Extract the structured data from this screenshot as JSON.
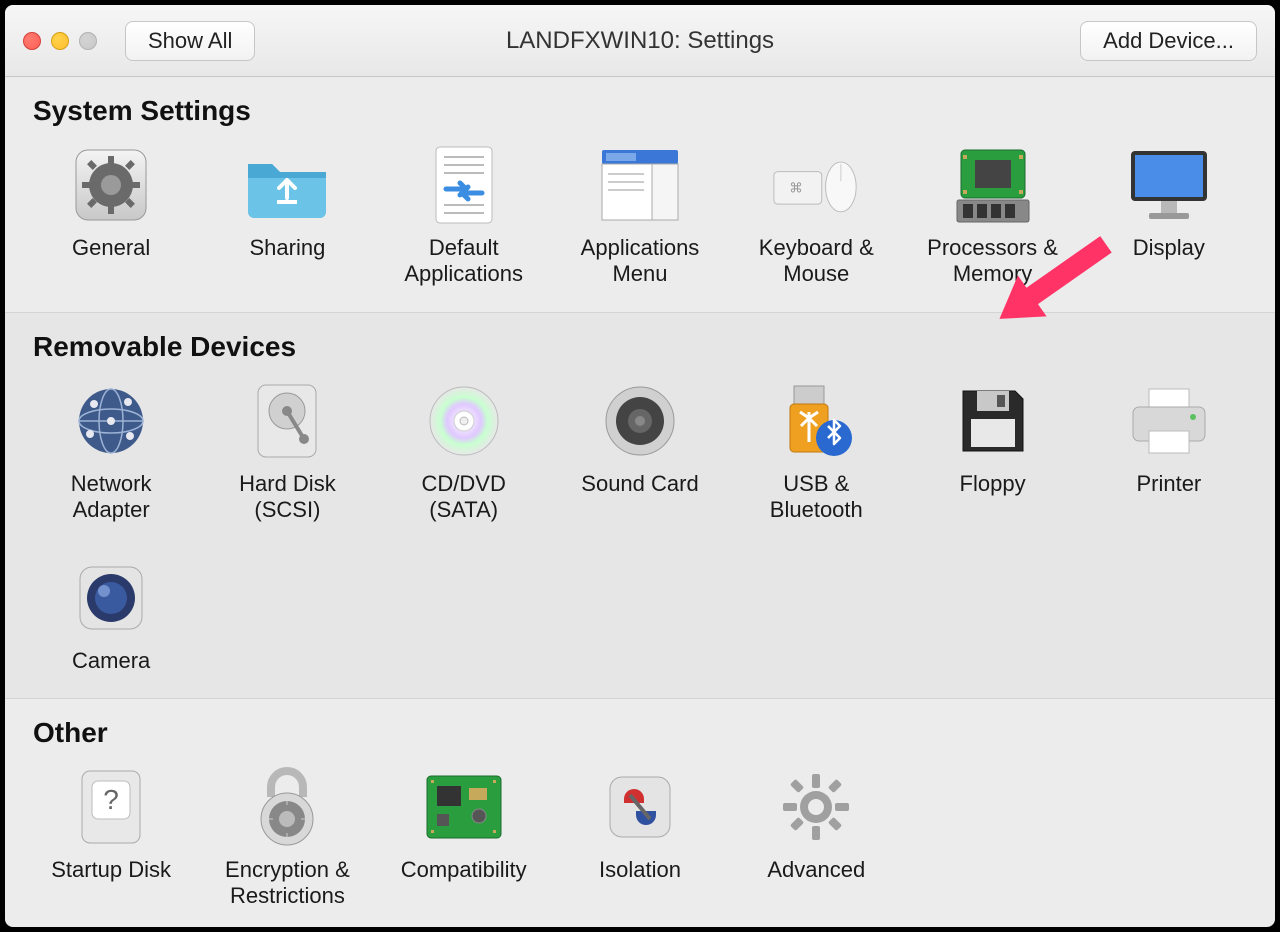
{
  "titlebar": {
    "show_all": "Show All",
    "title": "LANDFXWIN10: Settings",
    "add_device": "Add Device..."
  },
  "sections": {
    "system": {
      "title": "System Settings",
      "items": [
        {
          "label": "General"
        },
        {
          "label": "Sharing"
        },
        {
          "label": "Default Applications"
        },
        {
          "label": "Applications Menu"
        },
        {
          "label": "Keyboard & Mouse"
        },
        {
          "label": "Processors & Memory"
        },
        {
          "label": "Display"
        }
      ]
    },
    "removable": {
      "title": "Removable Devices",
      "items": [
        {
          "label": "Network Adapter"
        },
        {
          "label": "Hard Disk (SCSI)"
        },
        {
          "label": "CD/DVD (SATA)"
        },
        {
          "label": "Sound Card"
        },
        {
          "label": "USB & Bluetooth"
        },
        {
          "label": "Floppy"
        },
        {
          "label": "Printer"
        },
        {
          "label": "Camera"
        }
      ]
    },
    "other": {
      "title": "Other",
      "items": [
        {
          "label": "Startup Disk"
        },
        {
          "label": "Encryption & Restrictions"
        },
        {
          "label": "Compatibility"
        },
        {
          "label": "Isolation"
        },
        {
          "label": "Advanced"
        }
      ]
    }
  }
}
